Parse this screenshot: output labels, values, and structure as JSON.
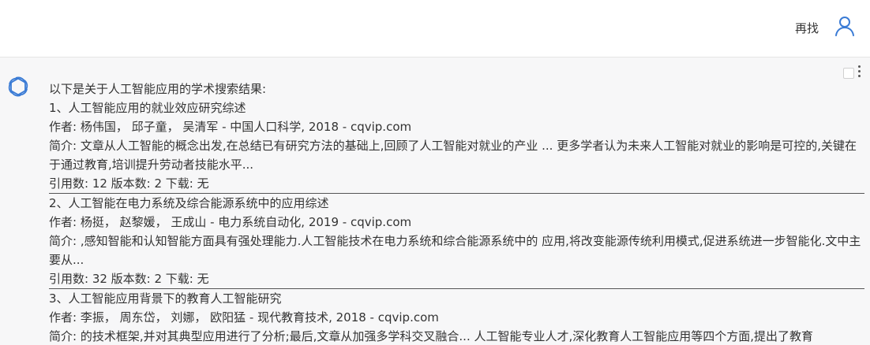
{
  "header": {
    "again_label": "再找",
    "user_icon": "user-icon"
  },
  "response": {
    "intro": "以下是关于人工智能应用的学术搜索结果:",
    "results": [
      {
        "title": "1、人工智能应用的就业效应研究综述",
        "authors": "作者: 杨伟国， 邱子童， 吴清军 - 中国人口科学, 2018 - cqvip.com",
        "summary": "简介: 文章从人工智能的概念出发,在总结已有研究方法的基础上,回顾了人工智能对就业的产业 ... 更多学者认为未来人工智能对就业的影响是可控的,关键在于通过教育,培训提升劳动者技能水平...",
        "stats": "引用数: 12 版本数: 2 下载: 无"
      },
      {
        "title": "2、人工智能在电力系统及综合能源系统中的应用综述",
        "authors": "作者: 杨挺， 赵黎媛， 王成山 - 电力系统自动化, 2019 - cqvip.com",
        "summary": "简介: ,感知智能和认知智能方面具有强处理能力.人工智能技术在电力系统和综合能源系统中的 应用,将改变能源传统利用模式,促进系统进一步智能化.文中主要从...",
        "stats": "引用数: 32 版本数: 2 下载: 无"
      },
      {
        "title": "3、人工智能应用背景下的教育人工智能研究",
        "authors": "作者: 李振， 周东岱， 刘娜， 欧阳猛 - 现代教育技术, 2018 - cqvip.com",
        "summary": "简介: 的技术框架,并对其典型应用进行了分析;最后,文章从加强多学科交叉融合... 人工智能专业人才,深化教育人工智能应用等四个方面,提出了教育",
        "stats": ""
      }
    ]
  },
  "colors": {
    "topbar_bg": "#ffffff",
    "content_bg": "#f7f7f8",
    "user_icon": "#3a7bd5",
    "logo": "#3a7bd5"
  }
}
